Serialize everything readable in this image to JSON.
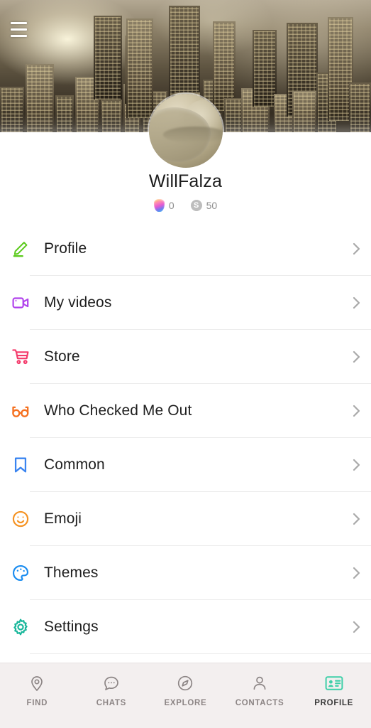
{
  "header": {
    "menu_icon": "hamburger-menu-icon",
    "cover_image": "city-skyline-at-night"
  },
  "profile": {
    "avatar": "user-avatar",
    "username": "WillFalza",
    "stats": [
      {
        "icon": "gem-icon",
        "value": "0"
      },
      {
        "icon": "coin-icon",
        "symbol": "S",
        "value": "50"
      }
    ]
  },
  "menu": {
    "items": [
      {
        "label": "Profile",
        "icon": "pencil-edit-icon",
        "color": "#5ecb20"
      },
      {
        "label": "My videos",
        "icon": "video-camera-icon",
        "color": "#b042ec"
      },
      {
        "label": "Store",
        "icon": "shopping-cart-icon",
        "color": "#f43a6b"
      },
      {
        "label": "Who Checked Me Out",
        "icon": "eyeglasses-icon",
        "color": "#f5701f"
      },
      {
        "label": "Common",
        "icon": "bookmark-icon",
        "color": "#3a84f0"
      },
      {
        "label": "Emoji",
        "icon": "smiley-face-icon",
        "color": "#f59221"
      },
      {
        "label": "Themes",
        "icon": "paint-palette-icon",
        "color": "#1a8cf0"
      },
      {
        "label": "Settings",
        "icon": "gear-icon",
        "color": "#17b69a"
      }
    ],
    "chevron_icon": "chevron-right-icon"
  },
  "bottom_nav": {
    "items": [
      {
        "label": "FIND",
        "icon": "location-pin-icon",
        "active": false
      },
      {
        "label": "CHATS",
        "icon": "chat-bubble-icon",
        "active": false
      },
      {
        "label": "EXPLORE",
        "icon": "compass-icon",
        "active": false
      },
      {
        "label": "CONTACTS",
        "icon": "person-icon",
        "active": false
      },
      {
        "label": "PROFILE",
        "icon": "id-card-icon",
        "active": true
      }
    ],
    "active_color": "#3ecfa8"
  }
}
